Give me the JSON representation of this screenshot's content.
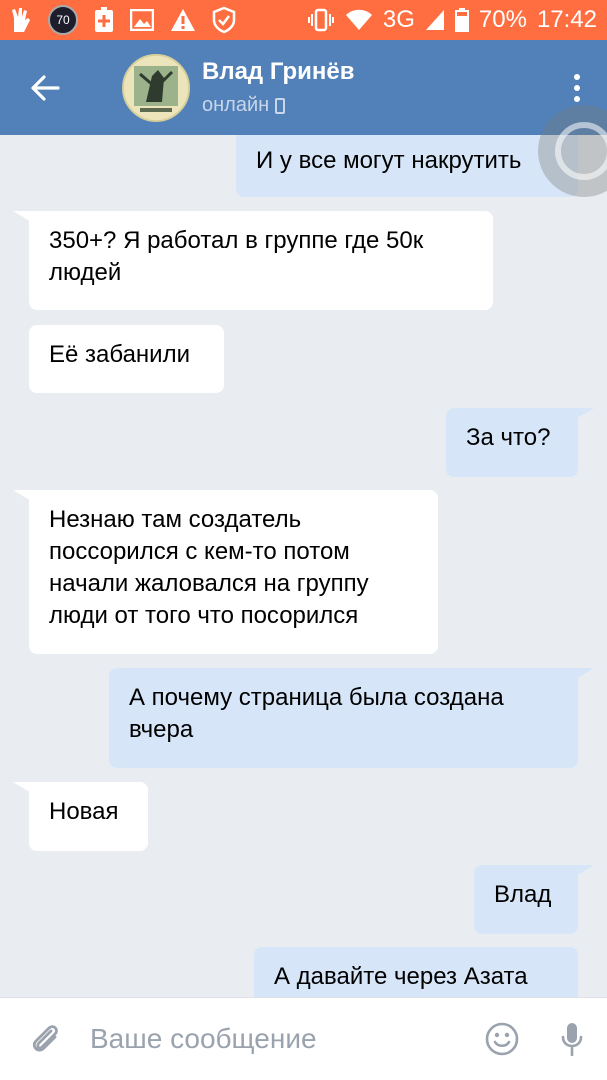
{
  "status_bar": {
    "notification_badge": "70",
    "network": "3G",
    "battery": "70%",
    "time": "17:42"
  },
  "header": {
    "name": "Влад Гринёв",
    "status": "онлайн"
  },
  "messages": [
    {
      "dir": "out",
      "text": "И у все могут накрутить"
    },
    {
      "dir": "in",
      "text": "350+? Я работал в группе где 50к людей"
    },
    {
      "dir": "in",
      "text": "Её забанили"
    },
    {
      "dir": "out",
      "text": "За что?"
    },
    {
      "dir": "in",
      "text": "Незнаю там создатель поссорился с кем-то потом начали жаловался на группу люди от того что посорился"
    },
    {
      "dir": "out",
      "text": "А почему страница была создана вчера"
    },
    {
      "dir": "in",
      "text": "Новая"
    },
    {
      "dir": "out",
      "text": "Влад"
    },
    {
      "dir": "out",
      "text": "А давайте через Азата"
    }
  ],
  "composer": {
    "placeholder": "Ваше сообщение"
  },
  "colors": {
    "status_bar": "#ff6e40",
    "header": "#5181b8",
    "chat_bg": "#e9edf1",
    "bubble_in": "#ffffff",
    "bubble_out": "#d6e6f8"
  }
}
